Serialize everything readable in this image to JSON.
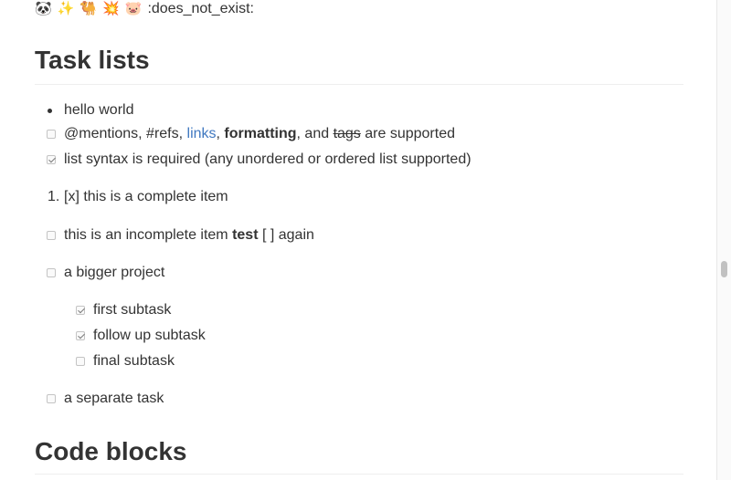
{
  "emoji_line": {
    "icons": [
      {
        "name": "panda-icon",
        "glyph": "🐼"
      },
      {
        "name": "sparkles-icon",
        "glyph": "✨"
      },
      {
        "name": "camel-icon",
        "glyph": "🐫"
      },
      {
        "name": "boom-icon",
        "glyph": "💥"
      },
      {
        "name": "pig-icon",
        "glyph": "🐷"
      }
    ],
    "shortcode": ":does_not_exist:"
  },
  "section_tasks": {
    "title": "Task lists"
  },
  "bullets": [
    {
      "text": "hello world"
    }
  ],
  "mentions_line": {
    "prefix": "@mentions, #refs, ",
    "link": "links",
    "sep1": ", ",
    "bold": "formatting",
    "sep2": ", and ",
    "strike": "tags",
    "suffix": " are supported"
  },
  "syntax_item": {
    "text": "list syntax is required (any unordered or ordered list supported)",
    "checked": true
  },
  "ordered_item": {
    "number": "1.",
    "text": "[x] this is a complete item"
  },
  "incomplete_item": {
    "prefix": "this is an incomplete item ",
    "bold": "test",
    "suffix": " [ ] again",
    "checked": false
  },
  "bigger_project": {
    "text": "a bigger project",
    "checked": false
  },
  "subtasks": [
    {
      "text": "first subtask",
      "checked": true
    },
    {
      "text": "follow up subtask",
      "checked": true
    },
    {
      "text": "final subtask",
      "checked": false
    }
  ],
  "separate_task": {
    "text": "a separate task",
    "checked": false
  },
  "section_code": {
    "title": "Code blocks"
  },
  "colors": {
    "link": "#4078c0",
    "text": "#333333",
    "rule": "#eeeeee"
  }
}
